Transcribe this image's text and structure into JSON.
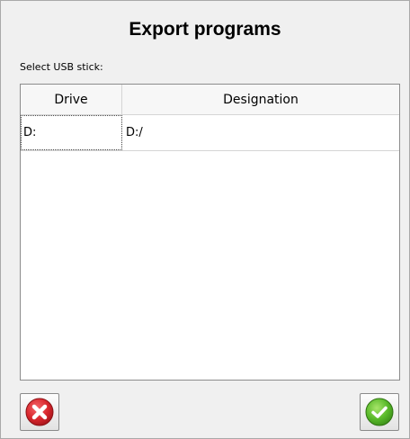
{
  "dialog": {
    "title": "Export programs",
    "select_label": "Select USB stick:"
  },
  "table": {
    "columns": [
      "Drive",
      "Designation"
    ],
    "rows": [
      {
        "drive": "D:",
        "designation": "D:/"
      }
    ]
  },
  "buttons": {
    "cancel_icon": "red-x-circle-icon",
    "confirm_icon": "green-check-circle-icon"
  },
  "colors": {
    "cancel_red": "#d8262c",
    "confirm_green": "#58b929"
  }
}
